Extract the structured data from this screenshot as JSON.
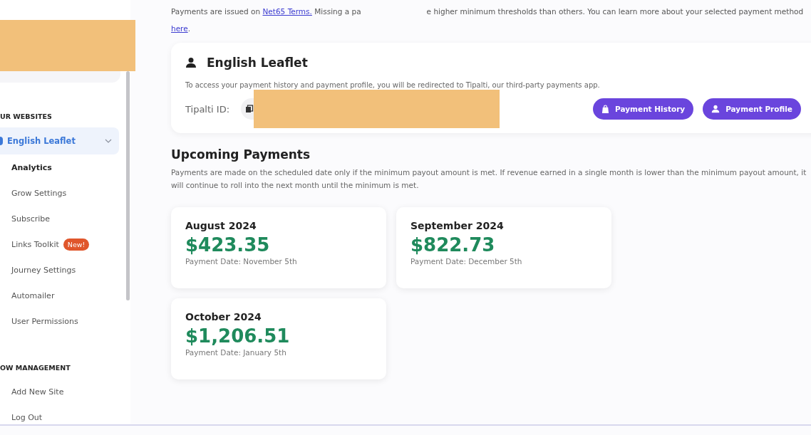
{
  "sidebar": {
    "sections": [
      {
        "heading": "UR WEBSITES",
        "items": [
          {
            "label": "English Leaflet",
            "kind": "site",
            "selected": true,
            "expanded": true
          },
          {
            "label": "Analytics",
            "kind": "link",
            "selected": true
          },
          {
            "label": "Grow Settings",
            "kind": "link",
            "selected": false
          },
          {
            "label": "Subscribe",
            "kind": "link",
            "selected": false
          },
          {
            "label": "Links Toolkit",
            "kind": "link",
            "selected": false,
            "badge": "New!"
          },
          {
            "label": "Journey Settings",
            "kind": "link",
            "selected": false
          },
          {
            "label": "Automailer",
            "kind": "link",
            "selected": false
          },
          {
            "label": "User Permissions",
            "kind": "link",
            "selected": false
          }
        ]
      },
      {
        "heading": "OW MANAGEMENT",
        "items": [
          {
            "label": "Add New Site",
            "kind": "link",
            "selected": false
          },
          {
            "label": "Log Out",
            "kind": "link",
            "selected": false
          }
        ]
      }
    ]
  },
  "intro": {
    "before": "Payments are issued on ",
    "link": "Net65 Terms.",
    "middle": " Missing a pa",
    "after": "e higher minimum thresholds than others. You can learn more about your selected payment method ",
    "link2": "here",
    "end": "."
  },
  "account": {
    "title": "English Leaflet",
    "note": "To access your payment history and payment profile, you will be redirected to Tipalti, our third-party payments app.",
    "id_label": "Tipalti ID:",
    "buttons": [
      {
        "label": "Payment History",
        "kind": "history"
      },
      {
        "label": "Payment Profile",
        "kind": "profile"
      }
    ]
  },
  "upcoming": {
    "title": "Upcoming Payments",
    "note": "Payments are made on the scheduled date only if the minimum payout amount is met. If revenue earned in a single month is lower than the minimum payout amount, it will continue to roll into the next month until the minimum is met.",
    "payments": [
      {
        "month": "August 2024",
        "amount": "$423.35",
        "date": "Payment Date: November 5th"
      },
      {
        "month": "September 2024",
        "amount": "$822.73",
        "date": "Payment Date: December 5th"
      },
      {
        "month": "October 2024",
        "amount": "$1,206.51",
        "date": "Payment Date: January 5th"
      }
    ]
  }
}
